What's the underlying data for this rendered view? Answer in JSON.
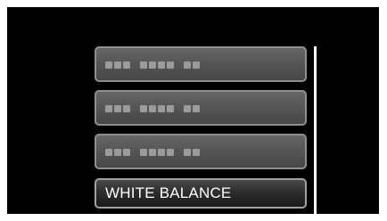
{
  "menu": {
    "items": [
      {
        "label": "",
        "placeholder_groups": [
          3,
          4,
          2
        ]
      },
      {
        "label": "",
        "placeholder_groups": [
          3,
          4,
          2
        ]
      },
      {
        "label": "",
        "placeholder_groups": [
          3,
          4,
          2
        ]
      },
      {
        "label": "WHITE BALANCE"
      }
    ],
    "selected_index": 3
  },
  "colors": {
    "screen_background": "#000000",
    "item_border": "#8f8f8f",
    "item_background": "#555555",
    "selected_background": "#2e2e2e",
    "placeholder_dot": "#9b9b9b",
    "text": "#ffffff",
    "scrollbar": "#ffffff"
  }
}
